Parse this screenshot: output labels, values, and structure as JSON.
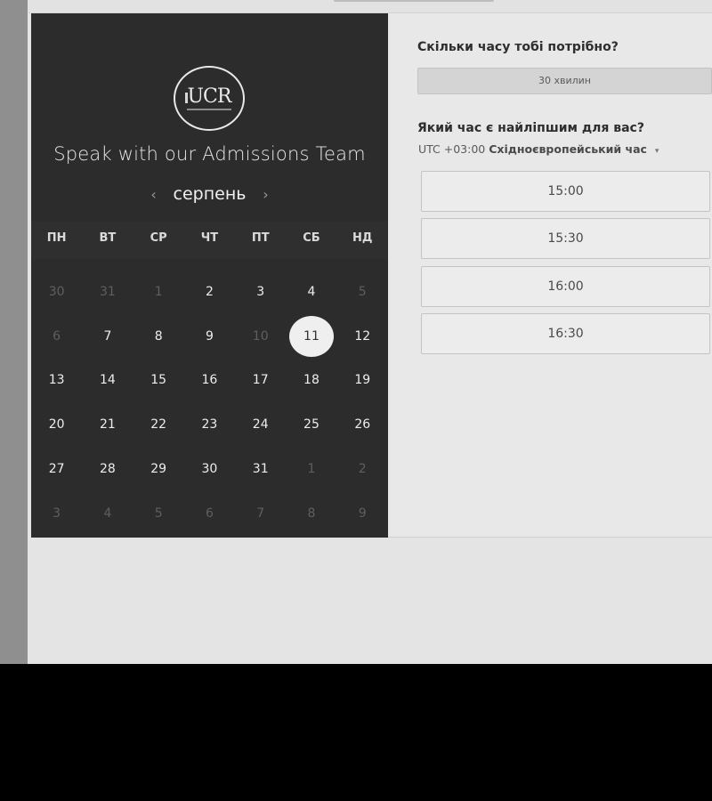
{
  "calendar": {
    "logo_text": "UCR",
    "title": "Speak with our Admissions Team",
    "month": "серпень",
    "prev_icon": "chevron-left-icon",
    "next_icon": "chevron-right-icon",
    "weekdays": [
      "ПН",
      "ВТ",
      "СР",
      "ЧТ",
      "ПТ",
      "СБ",
      "НД"
    ],
    "weeks": [
      [
        {
          "d": "30",
          "muted": true
        },
        {
          "d": "31",
          "muted": true
        },
        {
          "d": "1",
          "muted": true
        },
        {
          "d": "2"
        },
        {
          "d": "3"
        },
        {
          "d": "4"
        },
        {
          "d": "5",
          "muted": true
        }
      ],
      [
        {
          "d": "6",
          "muted": true
        },
        {
          "d": "7"
        },
        {
          "d": "8"
        },
        {
          "d": "9"
        },
        {
          "d": "10",
          "muted": true
        },
        {
          "d": "11",
          "selected": true
        },
        {
          "d": "12"
        }
      ],
      [
        {
          "d": "13"
        },
        {
          "d": "14"
        },
        {
          "d": "15"
        },
        {
          "d": "16"
        },
        {
          "d": "17"
        },
        {
          "d": "18"
        },
        {
          "d": "19"
        }
      ],
      [
        {
          "d": "20"
        },
        {
          "d": "21"
        },
        {
          "d": "22"
        },
        {
          "d": "23"
        },
        {
          "d": "24"
        },
        {
          "d": "25"
        },
        {
          "d": "26"
        }
      ],
      [
        {
          "d": "27"
        },
        {
          "d": "28"
        },
        {
          "d": "29"
        },
        {
          "d": "30"
        },
        {
          "d": "31"
        },
        {
          "d": "1",
          "muted": true
        },
        {
          "d": "2",
          "muted": true
        }
      ],
      [
        {
          "d": "3",
          "muted": true
        },
        {
          "d": "4",
          "muted": true
        },
        {
          "d": "5",
          "muted": true
        },
        {
          "d": "6",
          "muted": true
        },
        {
          "d": "7",
          "muted": true
        },
        {
          "d": "8",
          "muted": true
        },
        {
          "d": "9",
          "muted": true
        }
      ]
    ]
  },
  "booking": {
    "duration_question": "Скільки часу тобі потрібно?",
    "duration_value": "30 хвилин",
    "time_question": "Який час є найліпшим для вас?",
    "tz_offset": "UTC +03:00",
    "tz_name": "Східноєвропейський час",
    "tz_caret": "▾",
    "slots": [
      "15:00",
      "15:30",
      "16:00",
      "16:30"
    ]
  },
  "colors": {
    "panel_dark": "#2c2c2c",
    "page_bg": "#e4e4e4"
  }
}
